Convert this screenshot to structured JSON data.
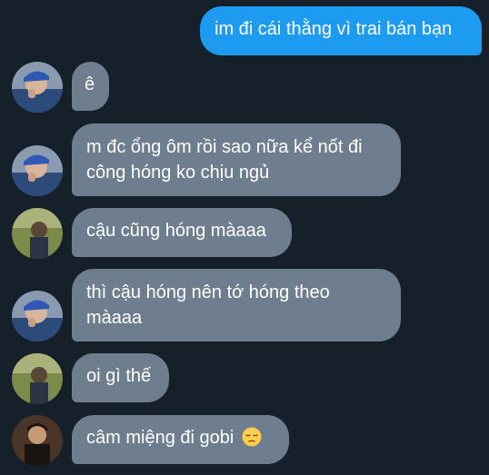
{
  "messages": [
    {
      "direction": "out",
      "text": "im đi cái thằng vì trai bán bạn"
    },
    {
      "direction": "in",
      "avatar": "avatar-blue-hat",
      "text": "ê"
    },
    {
      "direction": "in",
      "avatar": "avatar-blue-hat",
      "line1": "m đc ổng ôm rồi sao nữa kể nốt đi",
      "line2": "công hóng ko chịu ngủ"
    },
    {
      "direction": "in",
      "avatar": "avatar-outdoor",
      "text": "cậu cũng hóng màaaa"
    },
    {
      "direction": "in",
      "avatar": "avatar-blue-hat",
      "line1": "thì cậu hóng nên tớ hóng theo",
      "line2": "màaaa"
    },
    {
      "direction": "in",
      "avatar": "avatar-outdoor",
      "text": "oi gì thế"
    },
    {
      "direction": "in",
      "avatar": "avatar-dark-portrait",
      "text": "câm miệng đi gobi",
      "emoji": "pensive-face-icon"
    }
  ],
  "colors": {
    "background": "#15202b",
    "outgoing_bubble": "#1d9bf0",
    "incoming_bubble": "#6e7e8e",
    "text": "#ffffff"
  }
}
